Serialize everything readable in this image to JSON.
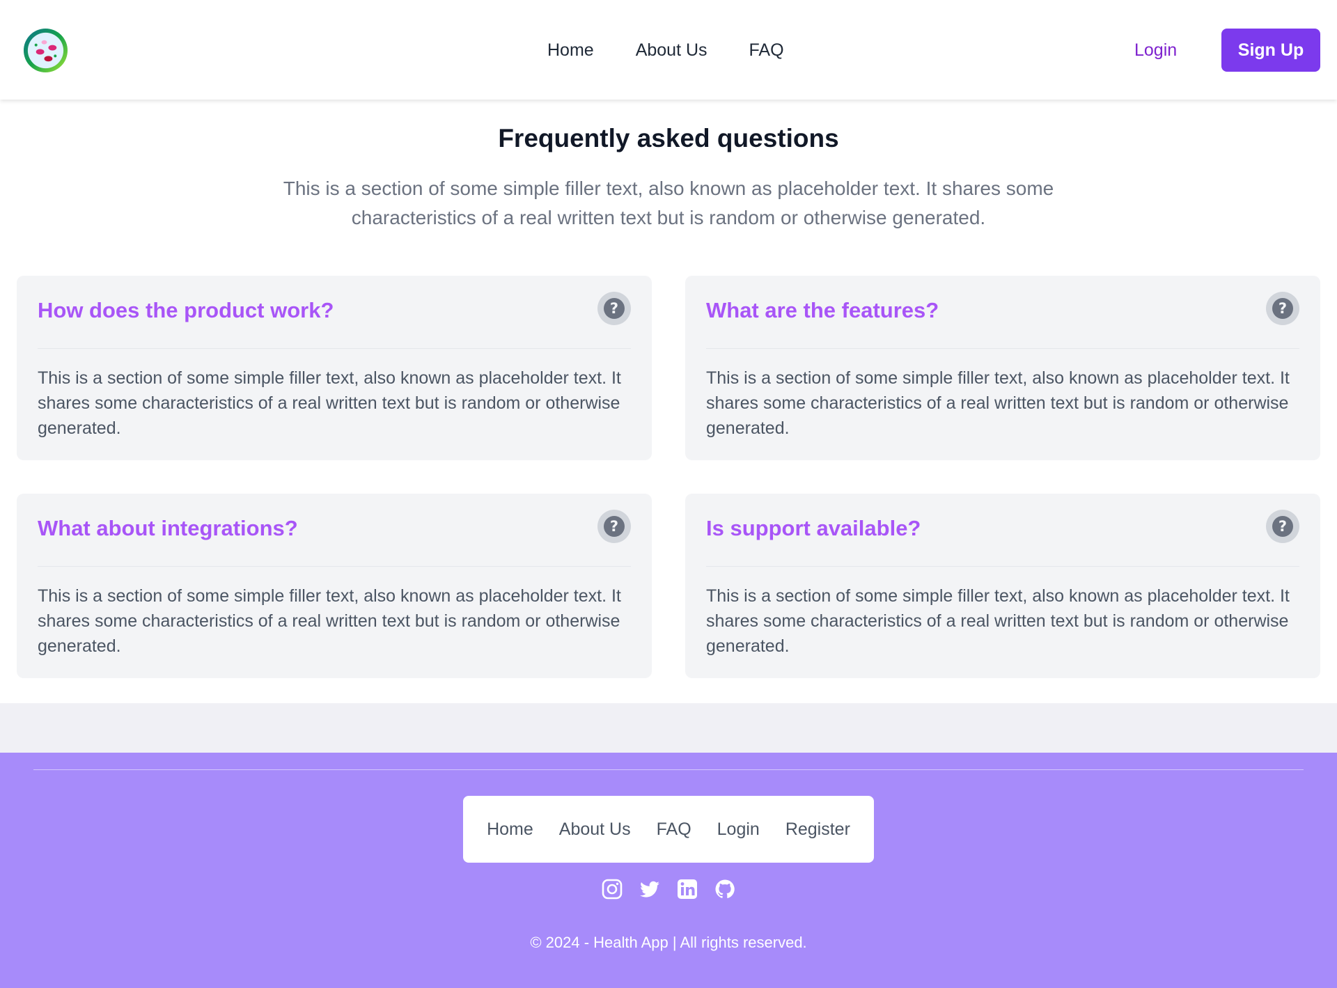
{
  "header": {
    "logo_icon": "health-app-logo",
    "nav": [
      "Home",
      "About Us",
      "FAQ"
    ],
    "login": "Login",
    "signup": "Sign Up"
  },
  "faq": {
    "title": "Frequently asked questions",
    "intro": "This is a section of some simple filler text, also known as placeholder text. It shares some characteristics of a real written text but is random or otherwise generated.",
    "help_icon": "question-mark-icon",
    "items": [
      {
        "question": "How does the product work?",
        "answer": "This is a section of some simple filler text, also known as placeholder text. It shares some characteristics of a real written text but is random or otherwise generated."
      },
      {
        "question": "What are the features?",
        "answer": "This is a section of some simple filler text, also known as placeholder text. It shares some characteristics of a real written text but is random or otherwise generated."
      },
      {
        "question": "What about integrations?",
        "answer": "This is a section of some simple filler text, also known as placeholder text. It shares some characteristics of a real written text but is random or otherwise generated."
      },
      {
        "question": "Is support available?",
        "answer": "This is a section of some simple filler text, also known as placeholder text. It shares some characteristics of a real written text but is random or otherwise generated."
      }
    ]
  },
  "footer": {
    "nav": [
      "Home",
      "About Us",
      "FAQ",
      "Login",
      "Register"
    ],
    "socials": [
      "instagram-icon",
      "twitter-icon",
      "linkedin-icon",
      "github-icon"
    ],
    "copyright": "© 2024 - Health App | All rights reserved."
  },
  "colors": {
    "accent": "#7c3aed",
    "question": "#a855f7",
    "footer_bg": "#a78bfa",
    "card_bg": "#f3f4f6"
  }
}
